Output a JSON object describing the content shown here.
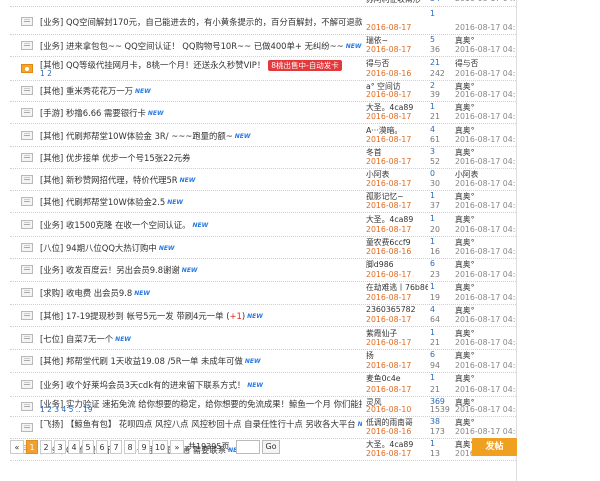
{
  "rows": [
    {
      "cat": "[业务]",
      "title": "QQ空间解封170元，自己能进去的，有小黄条提示的，百分百解封，不解可退款",
      "new": false,
      "pages": "",
      "badge": "",
      "author": "苏阿利征收兩形",
      "date": "",
      "replies": "34",
      "views": "",
      "last_user": "",
      "last_date": "2016-08-17 04:53",
      "hot": false
    },
    {
      "cat": "[业务]",
      "title": "QQ空间解封170元，自己能进去的，有小黄条提示的，百分百解封，不解可退款",
      "new": false,
      "pages": "",
      "badge": "",
      "author": "",
      "date": "2016-08-17",
      "replies": "1",
      "views": "",
      "last_user": "",
      "last_date": "2016-08-17 04:53",
      "hot": false
    },
    {
      "cat": "[业务]",
      "title": "进来拿包包~~ QQ空间认证！ QQ购物号10R~~ 已做400单+ 无纠纷~~",
      "new": true,
      "pages": "",
      "badge": "",
      "author": "瑞依~",
      "date": "2016-08-17",
      "replies": "5",
      "views": "36",
      "last_user": "真奥°",
      "last_date": "2016-08-17 04:53",
      "hot": false
    },
    {
      "cat": "[其他]",
      "title": "QQ等级代挂网月卡，8桃一个月！还送永久秒赞VIP！",
      "new": false,
      "pages": "1 2",
      "badge": "8桃出售中-自动发卡",
      "author": "得与否",
      "date": "2016-08-16",
      "replies": "21",
      "views": "242",
      "last_user": "得与否",
      "last_date": "2016-08-17 04:52",
      "hot": true
    },
    {
      "cat": "[其他]",
      "title": "重米秀花花万一万",
      "new": true,
      "pages": "",
      "badge": "",
      "author": "a° 空间访",
      "date": "2016-08-17",
      "replies": "2",
      "views": "39",
      "last_user": "真奥°",
      "last_date": "2016-08-17 04:52",
      "hot": false
    },
    {
      "cat": "[手游]",
      "title": "秒撸6.66   需要银行卡",
      "new": true,
      "pages": "",
      "badge": "",
      "author": "大圣。4ca89",
      "date": "2016-08-17",
      "replies": "1",
      "views": "21",
      "last_user": "真奥°",
      "last_date": "2016-08-17 04:52",
      "hot": false
    },
    {
      "cat": "[其他]",
      "title": "代刷邦帮堂10W体验金 3R/ ~~~跑量的额~",
      "new": true,
      "pages": "",
      "badge": "",
      "author": "A···漠暗。",
      "date": "2016-08-17",
      "replies": "4",
      "views": "61",
      "last_user": "真奥°",
      "last_date": "2016-08-17 04:51",
      "hot": false
    },
    {
      "cat": "[其他]",
      "title": "优步接单 优步一个号15张22元券",
      "new": false,
      "pages": "",
      "badge": "",
      "author": "冬首",
      "date": "2016-08-17",
      "replies": "3",
      "views": "52",
      "last_user": "真奥°",
      "last_date": "2016-08-17 04:51",
      "hot": false
    },
    {
      "cat": "[其他]",
      "title": "新秒赞网招代理，特价代理5R",
      "new": true,
      "pages": "",
      "badge": "",
      "author": "小阿表",
      "date": "2016-08-17",
      "replies": "0",
      "views": "30",
      "last_user": "小阿表",
      "last_date": "2016-08-17 04:50",
      "hot": false
    },
    {
      "cat": "[其他]",
      "title": "代刷邦帮堂10W体验金2.5",
      "new": true,
      "pages": "",
      "badge": "",
      "author": "孤影记忆~",
      "date": "2016-08-17",
      "replies": "1",
      "views": "37",
      "last_user": "真奥°",
      "last_date": "2016-08-17 04:49",
      "hot": false
    },
    {
      "cat": "[业务]",
      "title": "收1500克隆 在收一个空间认证。",
      "new": true,
      "pages": "",
      "badge": "",
      "author": "大圣。4ca89",
      "date": "2016-08-17",
      "replies": "1",
      "views": "20",
      "last_user": "真奥°",
      "last_date": "2016-08-17 04:49",
      "hot": false
    },
    {
      "cat": "[八位]",
      "title": "94期八位QQ大热订购中",
      "new": true,
      "pages": "",
      "badge": "",
      "author": "童农费6ccf9",
      "date": "2016-08-16",
      "replies": "1",
      "views": "16",
      "last_user": "真奥°",
      "last_date": "2016-08-17 04:48",
      "hot": false
    },
    {
      "cat": "[业务]",
      "title": "收发百度云！另出会员9.8谢谢",
      "new": true,
      "pages": "",
      "badge": "",
      "author": "脚d986",
      "date": "2016-08-17",
      "replies": "6",
      "views": "23",
      "last_user": "真奥°",
      "last_date": "2016-08-17 04:48",
      "hot": false
    },
    {
      "cat": "[求购]",
      "title": "收电费   出会员9.8",
      "new": true,
      "pages": "",
      "badge": "",
      "author": "在劫难逃丨76b86",
      "date": "2016-08-17",
      "replies": "1",
      "views": "19",
      "last_user": "真奥°",
      "last_date": "2016-08-17 04:48",
      "hot": false
    },
    {
      "cat": "[其他]",
      "title": "17-19提现秒到 帐号5元一发 带刷4元一单",
      "new": true,
      "pages": "",
      "badge": "+1",
      "author": "2360365782",
      "date": "2016-08-17",
      "replies": "4",
      "views": "64",
      "last_user": "真奥°",
      "last_date": "2016-08-17 04:47",
      "hot": false
    },
    {
      "cat": "[七位]",
      "title": "自菜7无一个",
      "new": true,
      "pages": "",
      "badge": "",
      "author": "紫霞仙子",
      "date": "2016-08-17",
      "replies": "1",
      "views": "21",
      "last_user": "真奥°",
      "last_date": "2016-08-17 04:47",
      "hot": false
    },
    {
      "cat": "[其他]",
      "title": "邦帮堂代刷 1天收益19.08 /5R一单 未成年可做",
      "new": true,
      "pages": "",
      "badge": "",
      "author": "扬",
      "date": "2016-08-17",
      "replies": "6",
      "views": "94",
      "last_user": "真奥°",
      "last_date": "2016-08-17 04:47",
      "hot": false
    },
    {
      "cat": "[业务]",
      "title": "收个好莱坞会员3天cdk有的进来留下联系方式！",
      "new": true,
      "pages": "",
      "badge": "",
      "author": "麦鱼0c4e",
      "date": "2016-08-17",
      "replies": "1",
      "views": "21",
      "last_user": "真奥°",
      "last_date": "2016-08-17 04:46",
      "hot": false
    },
    {
      "cat": "[业务]",
      "title": "实力验证 速拓免流 给你想要的稳定，给你想要的免流成果！鲸鱼一个月 你们能接受现状比吗？",
      "new": false,
      "pages": "1 2 3 4 5 .. 19",
      "badge": "+12",
      "author": "灵风",
      "date": "2016-08-10",
      "replies": "369",
      "views": "1539",
      "last_user": "真奥°",
      "last_date": "2016-08-17 04:46",
      "hot": false
    },
    {
      "cat": "[飞扬]",
      "title": "【鲸鱼有包】 花呗四点 风控八点 风控秒回十点  自录任性行十点 另收各大平台",
      "new": true,
      "pages": "",
      "badge": "",
      "author": "低调的雨南哥",
      "date": "2016-08-16",
      "replies": "38",
      "views": "173",
      "last_user": "真奥°",
      "last_date": "2016-08-17 04:45",
      "hot": false
    },
    {
      "cat": "[业务]",
      "title": "QQ付费音乐包 5.5一月 无限开通 需要联系",
      "new": true,
      "pages": "",
      "badge": "",
      "author": "大圣。4ca89",
      "date": "2016-08-17",
      "replies": "1",
      "views": "13",
      "last_user": "真奥°",
      "last_date": "2016-08-17 04:45",
      "hot": false
    }
  ],
  "pager": {
    "prev": "«",
    "pages": [
      "1",
      "2",
      "3",
      "4",
      "5",
      "6",
      "7",
      "8",
      "9",
      "10"
    ],
    "next": "»",
    "total": "共19395页",
    "go": "Go"
  },
  "post_button": "发帖"
}
